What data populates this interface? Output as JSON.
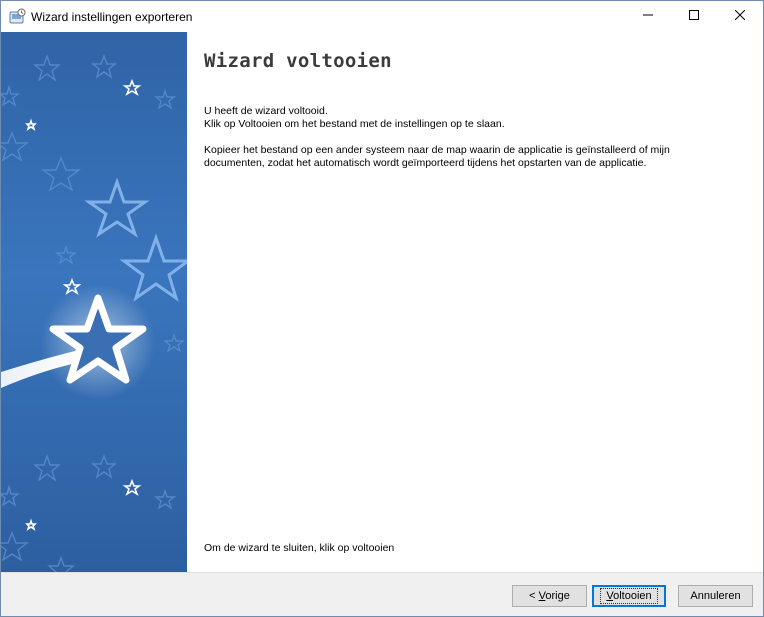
{
  "window": {
    "title": "Wizard instellingen exporteren"
  },
  "icons": {
    "app": "wizard-app-icon",
    "minimize": "minimize-icon",
    "maximize": "maximize-icon",
    "close": "close-icon",
    "banner": "star-banner-illustration"
  },
  "colors": {
    "banner_blue": "#3a75bd",
    "focus_blue": "#0078d7"
  },
  "page": {
    "title": "Wizard voltooien",
    "paragraph1": [
      "U heeft de wizard voltooid.",
      "Klik op Voltooien om het bestand met de instellingen op te slaan."
    ],
    "paragraph2": [
      "Kopieer het bestand op een ander systeem naar de map waarin de applicatie is geïnstalleerd of mijn",
      "documenten, zodat het automatisch wordt geïmporteerd tijdens het opstarten van de applicatie."
    ],
    "finish_hint": "Om de wizard te sluiten, klik op voltooien"
  },
  "buttons": {
    "prev_prefix": "< ",
    "prev_accel": "V",
    "prev_rest": "orige",
    "finish_accel": "V",
    "finish_rest": "oltooien",
    "cancel": "Annuleren"
  }
}
